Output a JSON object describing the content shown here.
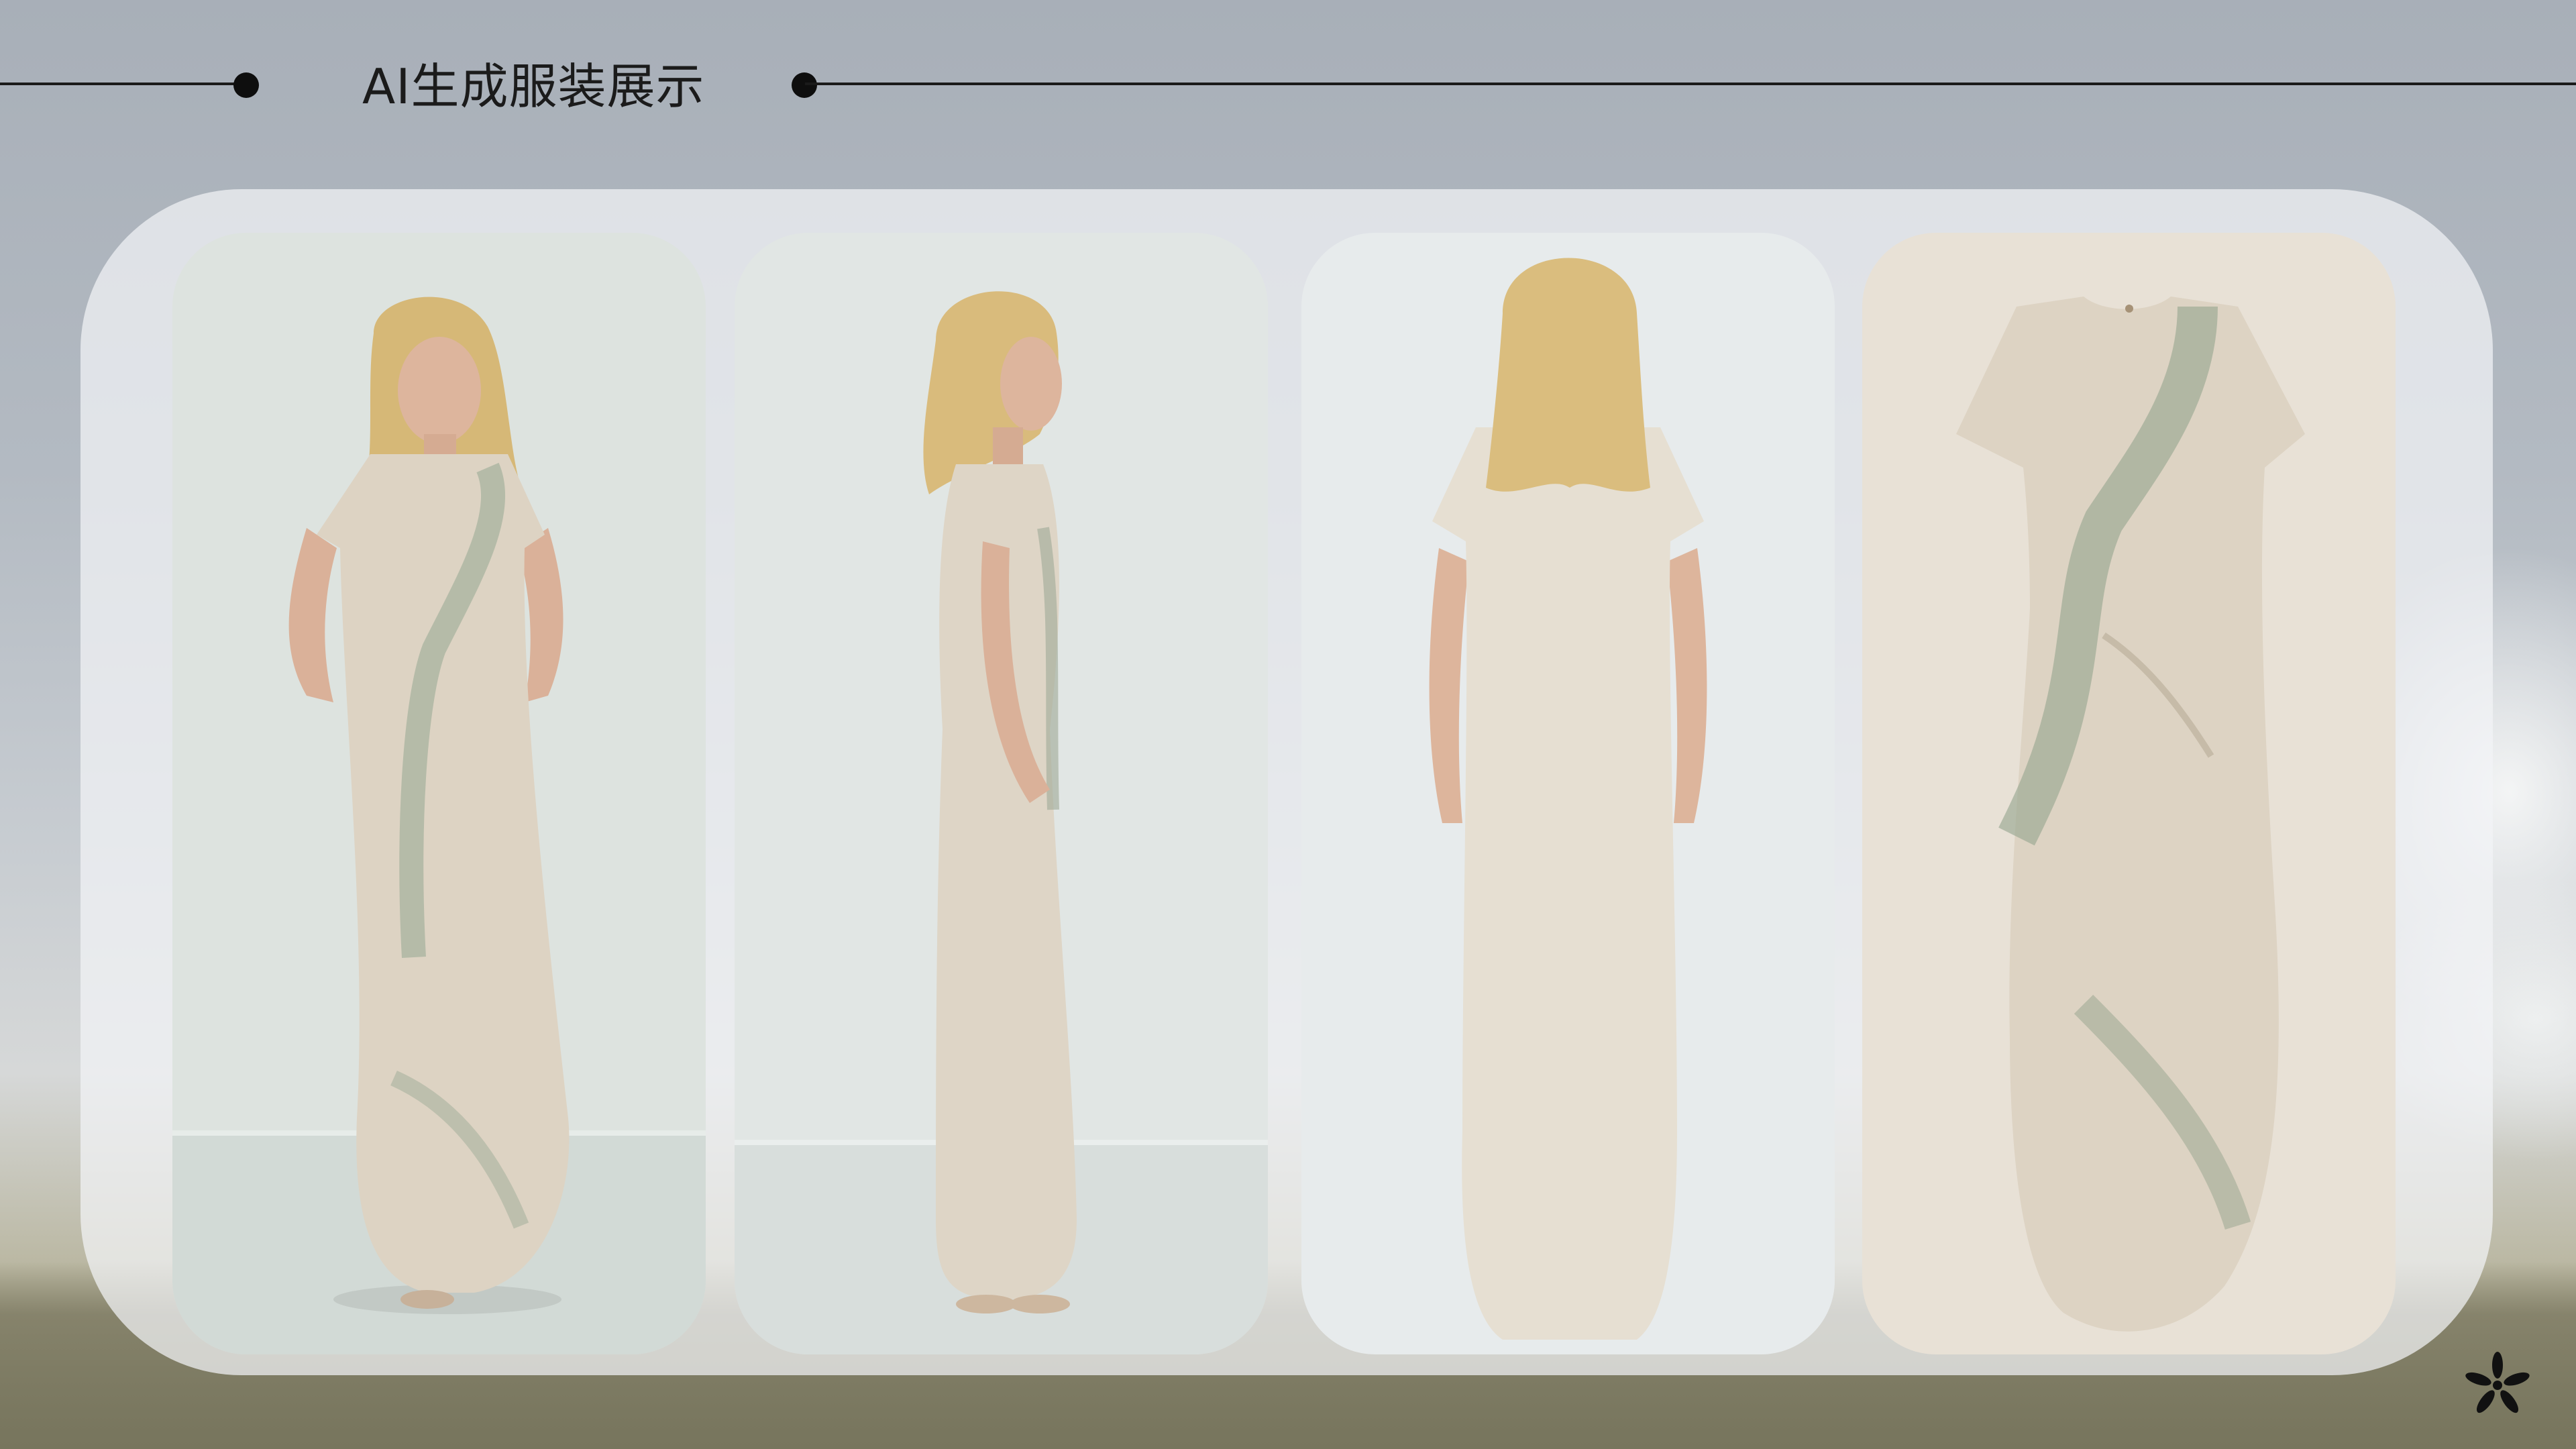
{
  "header": {
    "title": "AI生成服装展示"
  },
  "gallery": {
    "cards": [
      {
        "name": "front-view",
        "bg": "#dde3df"
      },
      {
        "name": "side-view",
        "bg": "#e1e6e4"
      },
      {
        "name": "back-view",
        "bg": "#e7ebec"
      },
      {
        "name": "flat-lay",
        "bg": "#e8e1d6"
      }
    ]
  },
  "colors": {
    "accent": "#111111",
    "dress": "#ddd3c3",
    "print": "#93a38e",
    "hair": "#d9bb7c",
    "skin": "#dcb39c"
  },
  "icons": {
    "corner_logo": "asterisk-flower-icon"
  }
}
